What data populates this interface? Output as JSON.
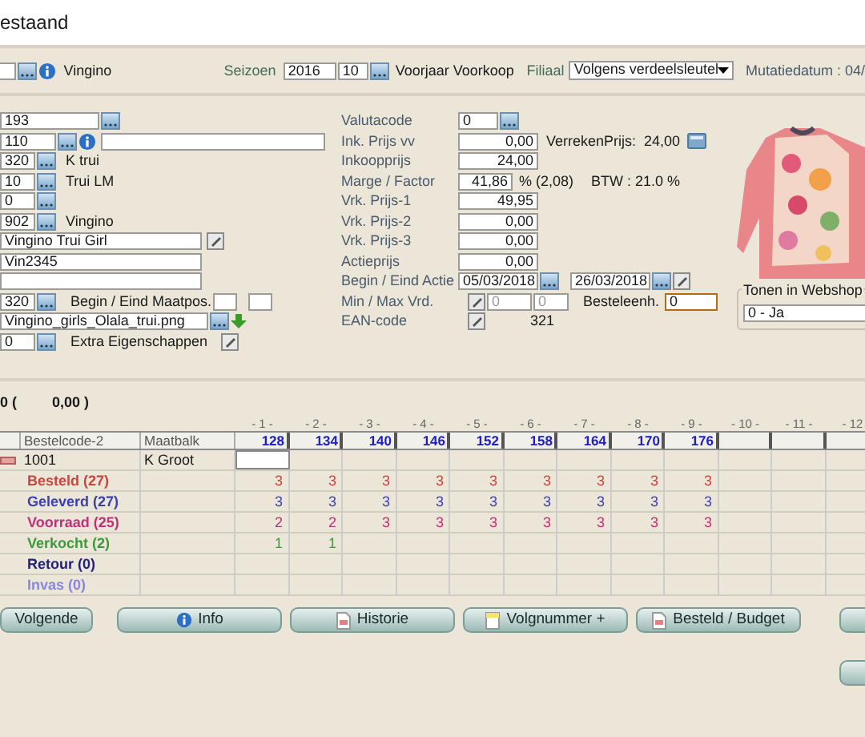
{
  "window": {
    "title": "estaand"
  },
  "toolbar": {
    "supplier": "Vingino",
    "season_label": "Seizoen",
    "season_year": "2016",
    "season_code": "10",
    "season_name": "Voorjaar Voorkoop",
    "branch_label": "Filiaal",
    "branch_value": "Volgens verdeelsleutel",
    "mutation_label": "Mutatiedatum : 04/"
  },
  "article_fields": [
    {
      "kind": "code_wide",
      "value": "193"
    },
    {
      "kind": "code_info",
      "value": "110"
    },
    {
      "kind": "code",
      "value": "320",
      "name": "K trui"
    },
    {
      "kind": "code",
      "value": "10",
      "name": "Trui LM"
    },
    {
      "kind": "code",
      "value": "0"
    },
    {
      "kind": "code",
      "value": "902",
      "name": "Vingino"
    },
    {
      "kind": "text_edit",
      "value": "Vingino Trui Girl"
    },
    {
      "kind": "text",
      "value": "Vin2345"
    },
    {
      "kind": "text"
    },
    {
      "kind": "range",
      "value": "320",
      "name": "Begin / Eind Maatpos."
    },
    {
      "kind": "file",
      "value": "Vingino_girls_Olala_trui.png"
    },
    {
      "kind": "extra",
      "value": "0",
      "name": "Extra Eigenschappen"
    }
  ],
  "price_fields": [
    {
      "kind": "lookup",
      "label": "Valutacode",
      "value": "0"
    },
    {
      "kind": "amount_extra",
      "label": "Ink. Prijs vv",
      "value": "0,00",
      "extra_label": "VerrekenPrijs:",
      "extra_value": "24,00"
    },
    {
      "kind": "amount",
      "label": "Inkoopprijs",
      "value": "24,00"
    },
    {
      "kind": "margin",
      "label": "Marge / Factor",
      "value": "41,86",
      "suffix": "% (2,08)",
      "vat": "BTW : 21.0 %"
    },
    {
      "kind": "amount",
      "label": "Vrk. Prijs-1",
      "value": "49,95"
    },
    {
      "kind": "amount",
      "label": "Vrk. Prijs-2",
      "value": "0,00"
    },
    {
      "kind": "amount",
      "label": "Vrk. Prijs-3",
      "value": "0,00"
    },
    {
      "kind": "amount",
      "label": "Actieprijs",
      "value": "0,00"
    },
    {
      "kind": "dates",
      "label": "Begin / Eind Actie",
      "value": "05/03/2018",
      "end_value": "26/03/2018"
    },
    {
      "kind": "minmax",
      "label": "Min / Max Vrd.",
      "value": "0",
      "max_value": "0",
      "disabled": true,
      "unit_label": "Besteleenh.",
      "unit_value": "0",
      "focused": true
    },
    {
      "kind": "ean",
      "label": "EAN-code",
      "value": "321"
    }
  ],
  "webshop": {
    "label": "Tonen in Webshop",
    "value": "0 - Ja"
  },
  "summary": {
    "count": "0 (",
    "amount": "0,00 )"
  },
  "grid": {
    "column_numbers": [
      "- 1 -",
      "- 2 -",
      "- 3 -",
      "- 4 -",
      "- 5 -",
      "- 6 -",
      "- 7 -",
      "- 8 -",
      "- 9 -",
      "- 10 -",
      "- 11 -",
      "- 12"
    ],
    "columns": [
      "Bestelcode-2",
      "Maatbalk"
    ],
    "sizes": [
      "128",
      "134",
      "140",
      "146",
      "152",
      "158",
      "164",
      "170",
      "176"
    ],
    "item": {
      "code": "1001",
      "size_bar": "K Groot"
    },
    "status_rows": [
      {
        "label": "Besteld (27)",
        "color": "#c8463f",
        "counts": [
          "3",
          "3",
          "3",
          "3",
          "3",
          "3",
          "3",
          "3",
          "3"
        ]
      },
      {
        "label": "Geleverd (27)",
        "color": "#3b3fb5",
        "counts": [
          "3",
          "3",
          "3",
          "3",
          "3",
          "3",
          "3",
          "3",
          "3"
        ]
      },
      {
        "label": "Voorraad (25)",
        "color": "#c0307a",
        "counts": [
          "2",
          "2",
          "3",
          "3",
          "3",
          "3",
          "3",
          "3",
          "3"
        ]
      },
      {
        "label": "Verkocht (2)",
        "color": "#3c9a3c",
        "counts": [
          "1",
          "1"
        ]
      },
      {
        "label": "Retour (0)",
        "color": "#22227a",
        "counts": []
      },
      {
        "label": "Invas (0)",
        "color": "#8a86e0",
        "counts": []
      }
    ]
  },
  "buttons": [
    {
      "label": "Volgende",
      "kind": "plain"
    },
    {
      "label": "Info",
      "kind": "info"
    },
    {
      "label": "Historie",
      "kind": "document"
    },
    {
      "label": "Volgnummer +",
      "kind": "note"
    },
    {
      "label": "Besteld / Budget",
      "kind": "document"
    }
  ]
}
